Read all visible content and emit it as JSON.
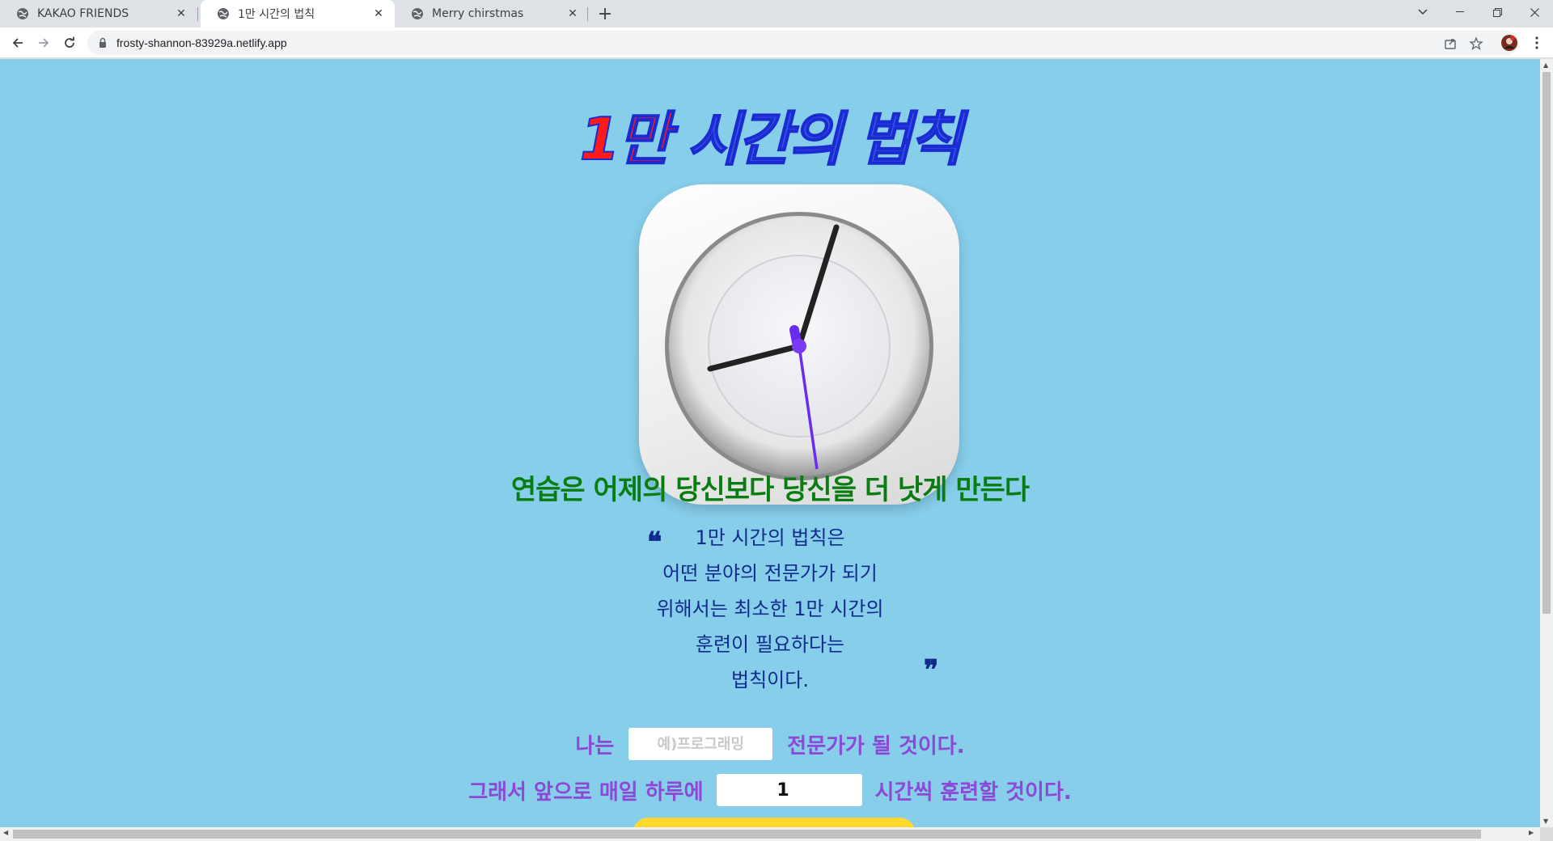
{
  "browser": {
    "tabs": [
      {
        "title": "KAKAO FRIENDS",
        "active": false
      },
      {
        "title": "1만 시간의 법칙",
        "active": true
      },
      {
        "title": "Merry chirstmas",
        "active": false
      }
    ],
    "address_url": "frosty-shannon-83929a.netlify.app"
  },
  "page": {
    "title_red": "1만",
    "title_blue": " 시간의 법칙",
    "subtitle": "연습은 어제의 당신보다 당신을 더 낫게 만든다",
    "quote_open": "❝",
    "quote_close": "❞",
    "quote_lines": [
      "1만 시간의 법칙은",
      "어떤 분야의 전문가가 되기",
      "위해서는 최소한 1만 시간의",
      "훈련이 필요하다는",
      "법칙이다."
    ],
    "form": {
      "line1_prefix": "나는",
      "field_placeholder": "예)프로그래밍",
      "line1_suffix": "전문가가 될 것이다.",
      "line2_prefix": "그래서 앞으로 매일 하루에",
      "hours_value": "1",
      "line2_suffix": "시간씩 훈련할 것이다."
    }
  },
  "colors": {
    "background": "#87ceeb",
    "title_red": "#ff1a1a",
    "title_blue": "#3158e8",
    "subtitle_green": "#0a7d12",
    "quote_navy": "#112b8c",
    "form_purple": "#8c49d6",
    "button_yellow": "#ffd92e"
  }
}
